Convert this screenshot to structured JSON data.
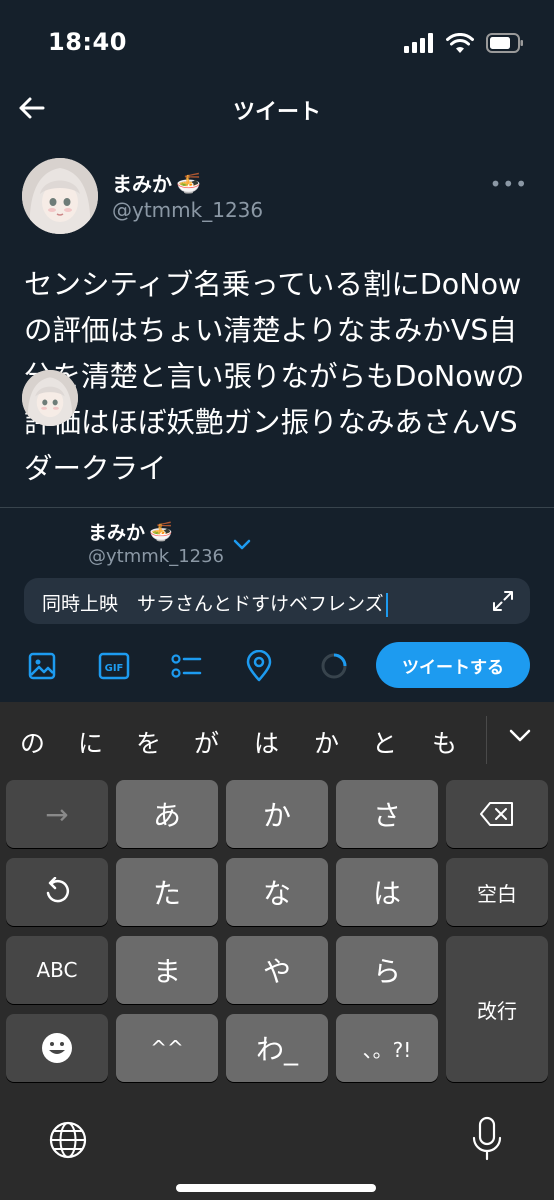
{
  "status_bar": {
    "time": "18:40",
    "icons": [
      "signal-icon",
      "wifi-icon",
      "battery-icon"
    ]
  },
  "header": {
    "back_icon": "arrow-left-icon",
    "title": "ツイート"
  },
  "tweet": {
    "display_name": "まみか",
    "name_emoji": "🍜",
    "handle": "@ytmmk_1236",
    "more_label": "•••",
    "text": "センシティブ名乗っている割にDoNowの評価はちょい清楚よりなまみかVS自分を清楚と言い張りながらもDoNowの評価はほぼ妖艶ガン振りなみあさんVSダークライ"
  },
  "composer": {
    "display_name": "まみか",
    "name_emoji": "🍜",
    "handle": "@ytmmk_1236",
    "reply_text": "同時上映　サラさんとドすけベフレンズ",
    "tweet_button": "ツイートする"
  },
  "toolbar": {
    "icons": [
      "image-icon",
      "gif-icon",
      "poll-icon",
      "location-icon",
      "character-count-icon"
    ],
    "gif_label": "GIF"
  },
  "keyboard": {
    "candidates": [
      "の",
      "に",
      "を",
      "が",
      "は",
      "か",
      "と",
      "も"
    ],
    "rows": [
      [
        "→",
        "あ",
        "か",
        "さ",
        "⌫"
      ],
      [
        "↺",
        "た",
        "な",
        "は",
        "空白"
      ],
      [
        "ABC",
        "ま",
        "や",
        "ら",
        "改行"
      ],
      [
        "☺",
        "^^",
        "わ_",
        "、。?!"
      ]
    ],
    "bottom_icons": [
      "globe-icon",
      "microphone-icon"
    ]
  },
  "colors": {
    "background": "#15202b",
    "accent": "#1d9bf0",
    "secondary_text": "#8b98a5",
    "keyboard_bg": "#2b2b2b"
  }
}
